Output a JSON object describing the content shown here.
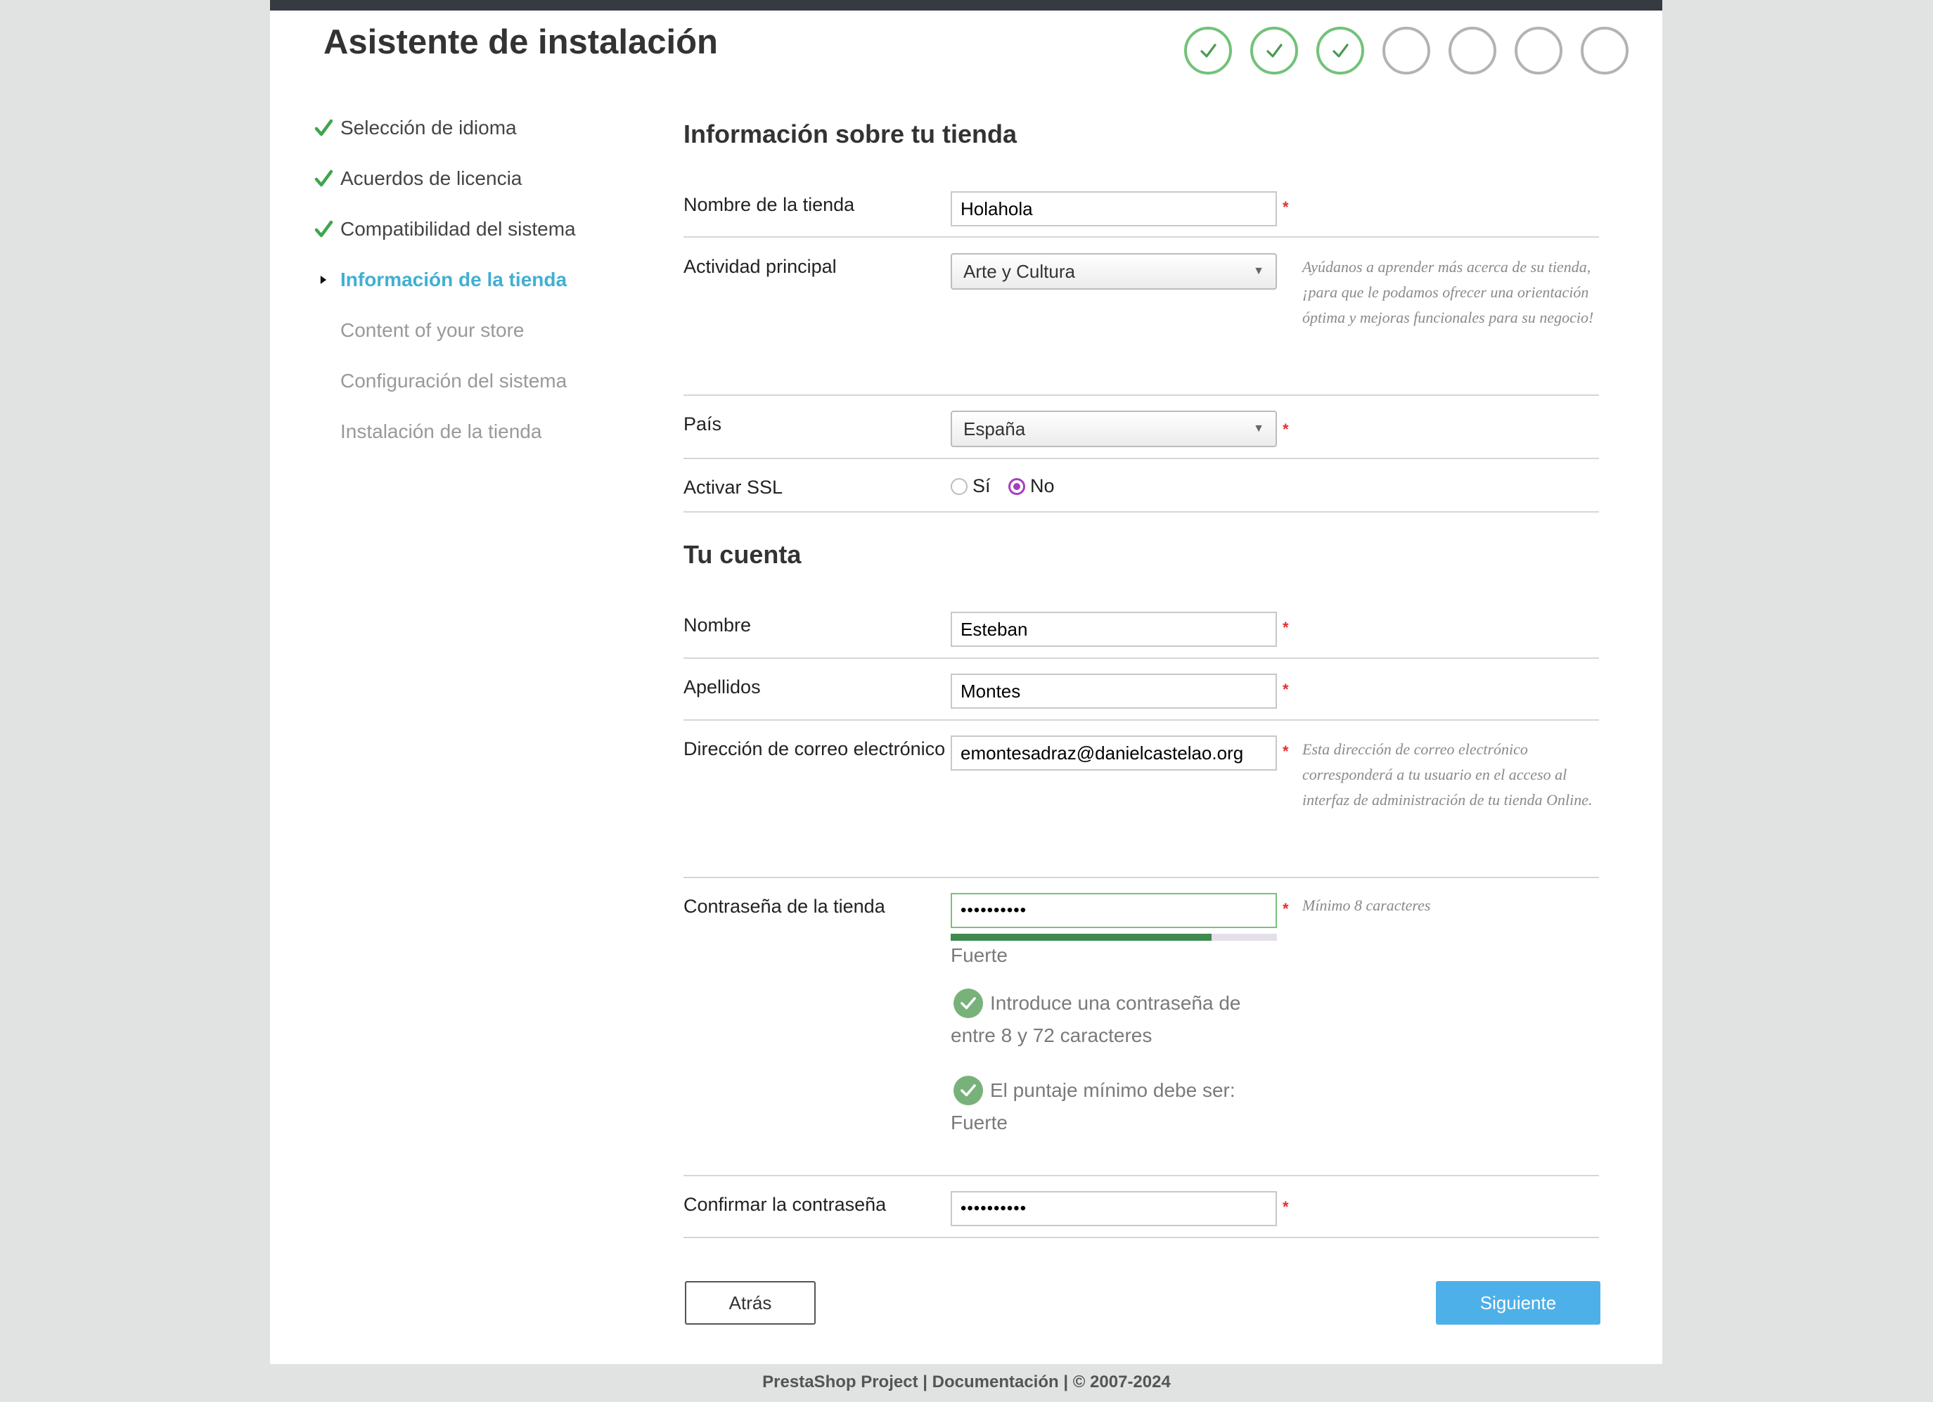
{
  "header": {
    "title": "Asistente de instalación",
    "steps_completed": 3,
    "steps_total": 7
  },
  "sidebar": {
    "items": [
      {
        "label": "Selección de idioma",
        "state": "done"
      },
      {
        "label": "Acuerdos de licencia",
        "state": "done"
      },
      {
        "label": "Compatibilidad del sistema",
        "state": "done"
      },
      {
        "label": "Información de la tienda",
        "state": "active"
      },
      {
        "label": "Content of your store",
        "state": "pending"
      },
      {
        "label": "Configuración del sistema",
        "state": "pending"
      },
      {
        "label": "Instalación de la tienda",
        "state": "pending"
      }
    ]
  },
  "store_section": {
    "title": "Información sobre tu tienda",
    "store_name": {
      "label": "Nombre de la tienda",
      "value": "Holahola",
      "required_mark": "*"
    },
    "activity": {
      "label": "Actividad principal",
      "value": "Arte y Cultura",
      "hint": "Ayúdanos a aprender más acerca de su tienda, ¡para que le podamos ofrecer una orientación óptima y mejoras funcionales para su negocio!"
    },
    "country": {
      "label": "País",
      "value": "España",
      "required_mark": "*"
    },
    "ssl": {
      "label": "Activar SSL",
      "option_yes": "Sí",
      "option_no": "No",
      "selected": "No"
    }
  },
  "account_section": {
    "title": "Tu cuenta",
    "first_name": {
      "label": "Nombre",
      "value": "Esteban",
      "required_mark": "*"
    },
    "last_name": {
      "label": "Apellidos",
      "value": "Montes",
      "required_mark": "*"
    },
    "email": {
      "label": "Dirección de correo electrónico",
      "value": "emontesadraz@danielcastelao.org",
      "required_mark": "*",
      "hint": "Esta dirección de correo electrónico corresponderá a tu usuario en el acceso al interfaz de administración de tu tienda Online."
    },
    "password": {
      "label": "Contraseña de la tienda",
      "value": "••••••••••",
      "required_mark": "*",
      "hint": "Mínimo 8 caracteres",
      "strength_label": "Fuerte",
      "strength_fraction": 0.8,
      "checks": [
        "Introduce una contraseña de entre 8 y 72 caracteres",
        "El puntaje mínimo debe ser: Fuerte"
      ]
    },
    "confirm_password": {
      "label": "Confirmar la contraseña",
      "value": "••••••••••",
      "required_mark": "*"
    }
  },
  "buttons": {
    "back": "Atrás",
    "next": "Siguiente"
  },
  "footer": {
    "text": "PrestaShop Project | Documentación | © 2007-2024"
  },
  "colors": {
    "accent_active": "#41afd3",
    "check_green": "#72c279",
    "primary_button": "#4eb0e9",
    "radio_selected": "#a43fbc",
    "required": "#e52f2f"
  },
  "icons": {
    "step_done": "checkmark-icon",
    "sidebar_done": "checkmark-icon",
    "sidebar_active": "caret-right-icon",
    "select_arrow": "chevron-down-icon",
    "password_check": "check-circle-icon"
  }
}
